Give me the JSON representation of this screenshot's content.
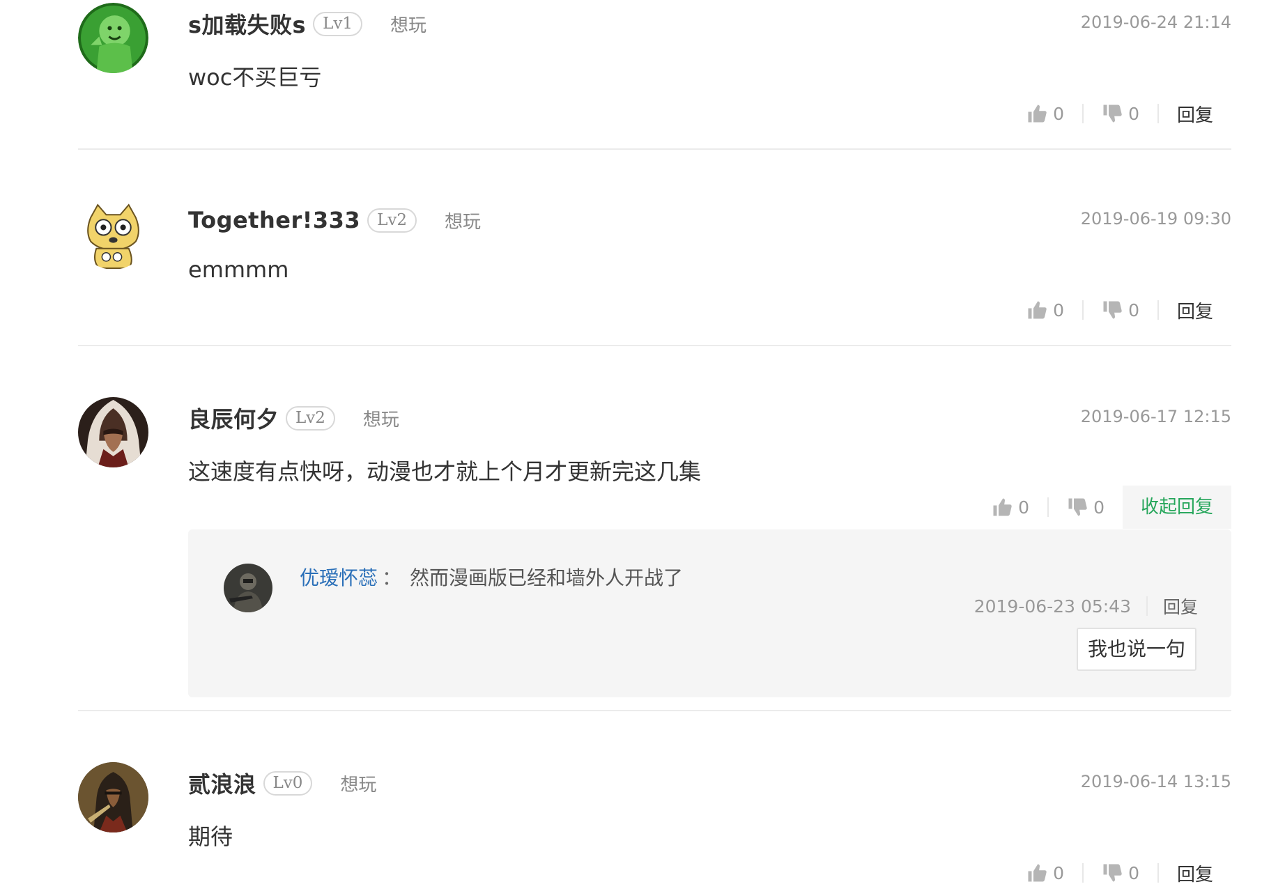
{
  "comments": [
    {
      "username": "s加载失败s",
      "level": "Lv1",
      "status": "想玩",
      "timestamp": "2019-06-24 21:14",
      "text": "woc不买巨亏",
      "likes": "0",
      "dislikes": "0",
      "reply_label": "回复",
      "avatar_icon": "green-cartoon-avatar-icon"
    },
    {
      "username": "Together!333",
      "level": "Lv2",
      "status": "想玩",
      "timestamp": "2019-06-19 09:30",
      "text": "emmmm",
      "likes": "0",
      "dislikes": "0",
      "reply_label": "回复",
      "avatar_icon": "cartoon-cat-avatar-icon"
    },
    {
      "username": "良辰何夕",
      "level": "Lv2",
      "status": "想玩",
      "timestamp": "2019-06-17 12:15",
      "text": "这速度有点快呀，动漫也才就上个月才更新完这几集",
      "likes": "0",
      "dislikes": "0",
      "reply_label": "收起回复",
      "avatar_icon": "hooded-assassin-avatar-icon",
      "replies": [
        {
          "username": "优瑷怀蕊",
          "colon": "：",
          "text": "然而漫画版已经和墙外人开战了",
          "timestamp": "2019-06-23 05:43",
          "reply_label": "回复",
          "avatar_icon": "soldier-avatar-icon"
        }
      ],
      "say_button": "我也说一句"
    },
    {
      "username": "贰浪浪",
      "level": "Lv0",
      "status": "想玩",
      "timestamp": "2019-06-14 13:15",
      "text": "期待",
      "likes": "0",
      "dislikes": "0",
      "reply_label": "回复",
      "avatar_icon": "dark-warrior-avatar-icon"
    }
  ],
  "colors": {
    "text": "#333333",
    "muted": "#999999",
    "accent_green": "#26a65b",
    "link_blue": "#2a6fb8",
    "reply_bg": "#f5f5f5",
    "divider": "#ebebeb"
  }
}
